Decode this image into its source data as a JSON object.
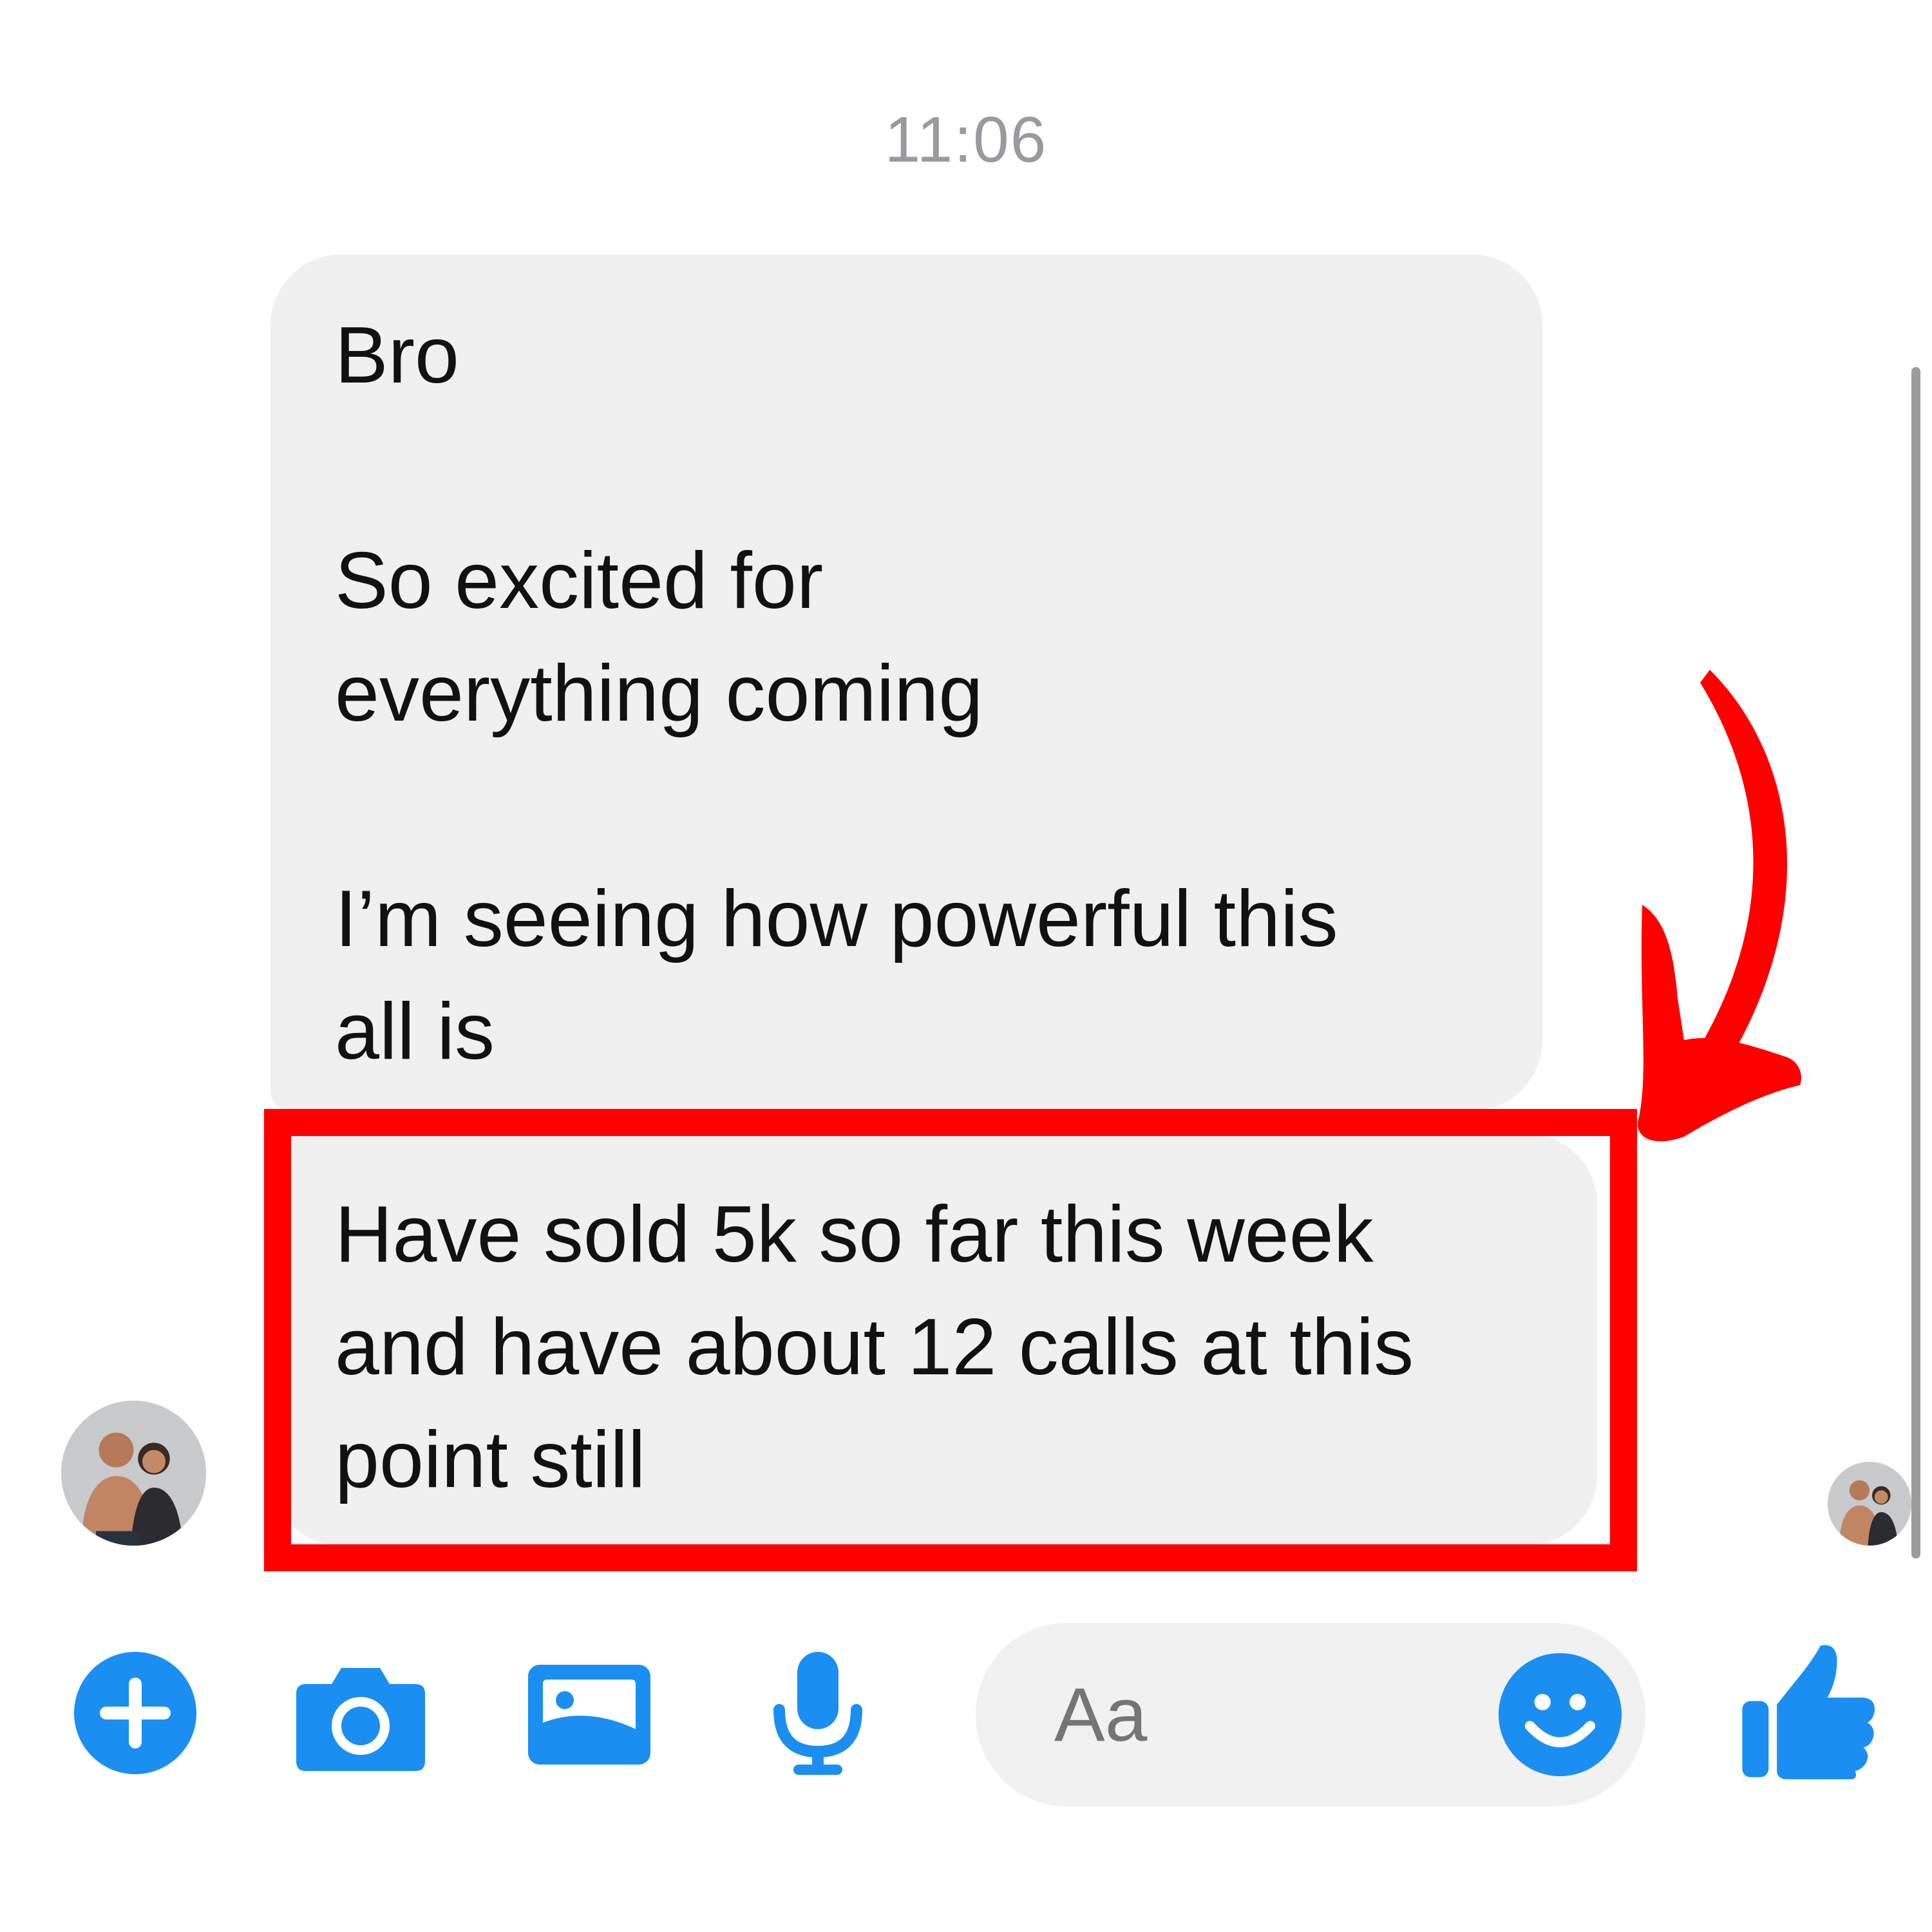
{
  "thread": {
    "timestamp": "11:06"
  },
  "messages": [
    {
      "lines": [
        "Bro",
        "",
        "So excited for",
        "everything coming",
        "",
        "I’m seeing how powerful this",
        "all is"
      ]
    },
    {
      "lines": [
        "Have sold 5k so far this week",
        "and have about 12 calls at this",
        "point still"
      ],
      "highlighted": true
    }
  ],
  "composer": {
    "placeholder": "Aa"
  },
  "icons": {
    "add": "plus-icon",
    "camera": "camera-icon",
    "gallery": "image-icon",
    "voice": "microphone-icon",
    "emoji": "smiley-icon",
    "like": "thumbs-up-icon",
    "annotation_arrow": "curved-arrow-icon"
  },
  "colors": {
    "accent": "#1b8ef2",
    "highlight": "#ff0000",
    "bubble": "#f0f0f0",
    "timestamp": "#9a9a9e"
  }
}
